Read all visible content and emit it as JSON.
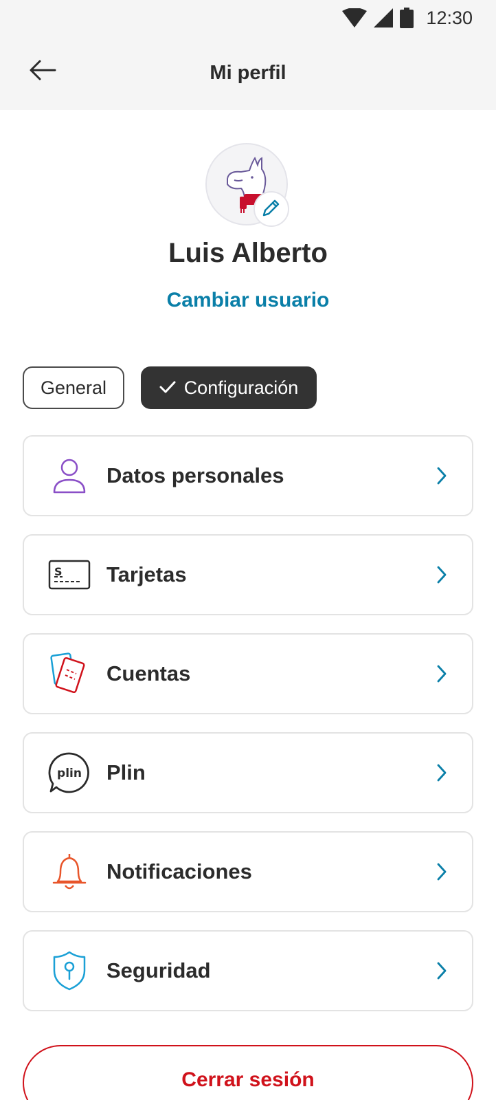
{
  "status_bar": {
    "time": "12:30",
    "icons": [
      "wifi-icon",
      "signal-icon",
      "battery-icon"
    ]
  },
  "app_bar": {
    "title": "Mi perfil",
    "back_icon": "arrow-left-icon"
  },
  "profile": {
    "name": "Luis Alberto",
    "change_user_label": "Cambiar usuario",
    "avatar_icon": "llama-avatar-icon",
    "edit_icon": "pencil-icon"
  },
  "tabs": [
    {
      "label": "General",
      "selected": false
    },
    {
      "label": "Configuración",
      "selected": true
    }
  ],
  "menu": [
    {
      "label": "Datos personales",
      "icon": "person-icon"
    },
    {
      "label": "Tarjetas",
      "icon": "card-icon"
    },
    {
      "label": "Cuentas",
      "icon": "accounts-icon"
    },
    {
      "label": "Plin",
      "icon": "plin-icon"
    },
    {
      "label": "Notificaciones",
      "icon": "bell-icon"
    },
    {
      "label": "Seguridad",
      "icon": "shield-icon"
    }
  ],
  "logout_label": "Cerrar sesión",
  "colors": {
    "accent_blue": "#0a7fa8",
    "brand_red": "#d0121b",
    "dark_chip": "#333333",
    "person_purple": "#8a4fc7",
    "bell_orange": "#e8552a",
    "shield_blue": "#1aa0d6"
  }
}
